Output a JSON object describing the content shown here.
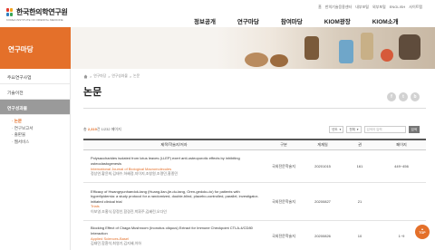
{
  "header": {
    "logo_text": "한국한의학연구원",
    "logo_sub": "KOREA INSTITUTE OF ORIENTAL MEDICINE",
    "util_links": [
      "홈",
      "한의기술응용센터",
      "내부포털",
      "외부포털",
      "ENGLISH",
      "사이트맵"
    ],
    "nav": [
      "정보공개",
      "연구마당",
      "참여마당",
      "KIOM광장",
      "KIOM소개"
    ]
  },
  "banner": {
    "title": "연구마당"
  },
  "sidebar": {
    "items": [
      "주요연구사업",
      "기술이전",
      "연구성과물"
    ],
    "active_index": 2,
    "subitems": [
      "논문",
      "연구보고서",
      "출판물",
      "웹서비스"
    ],
    "active_sub": 0
  },
  "breadcrumb": [
    "연구마당",
    "연구성과물",
    "논문"
  ],
  "page_title": "논문",
  "share": [
    "f",
    "t",
    "b"
  ],
  "toolbar": {
    "count_prefix": "총",
    "count": "2,319",
    "count_suffix": "건 1/232 페이지",
    "select1": "년도",
    "select2": "전체",
    "search_placeholder": "검색어 입력",
    "search_label": "검색"
  },
  "table": {
    "headers": [
      "제목/학술지/저자",
      "구분",
      "게재일",
      "권",
      "페이지"
    ],
    "rows": [
      {
        "title": "Polysaccharides isolated from lotus leaves (LLEP) exert anti-osteoporotic effects by inhibiting osteoclastogenesis",
        "journal": "International Journal of Biological Macromolecules",
        "authors": "정상연,황윤희,김태수,하혜정,지이지,조창원,조명민,홍종민",
        "category": "국외전문학술지",
        "date": "20201015",
        "volume": "161",
        "pages": "449~456"
      },
      {
        "title": "Efficacy of Hwangryunhaedok-tang (Huang-lian-jie-du-tang, Oren-gedoku-to) for patients with hyperlipidemia: a study protocol for a randomized, double-blind, placebo-controlled, parallel, investigator-initiated clinical trial",
        "journal": "Trials",
        "authors": "이보영,조홍식,장정인,함경진,박휘주,김혜린,오다인",
        "category": "국외전문학술지",
        "date": "20200827",
        "volume": "21",
        "pages": ""
      },
      {
        "title": "Blocking Effect of Chaga Mushroom (Inonotus oliquus) Extract for Immune Checkpoint CTLA-4/CD80 Interaction",
        "journal": "Applied Sciences-Basel",
        "authors": "김태민,함환석,최영기,김지혜,이하",
        "category": "국외전문학술지",
        "date": "20200826",
        "volume": "10",
        "pages": "1~9"
      }
    ]
  },
  "top_button": "TOP",
  "colors": {
    "accent": "#e4702a",
    "sidebar_active": "#9a9a9a"
  }
}
